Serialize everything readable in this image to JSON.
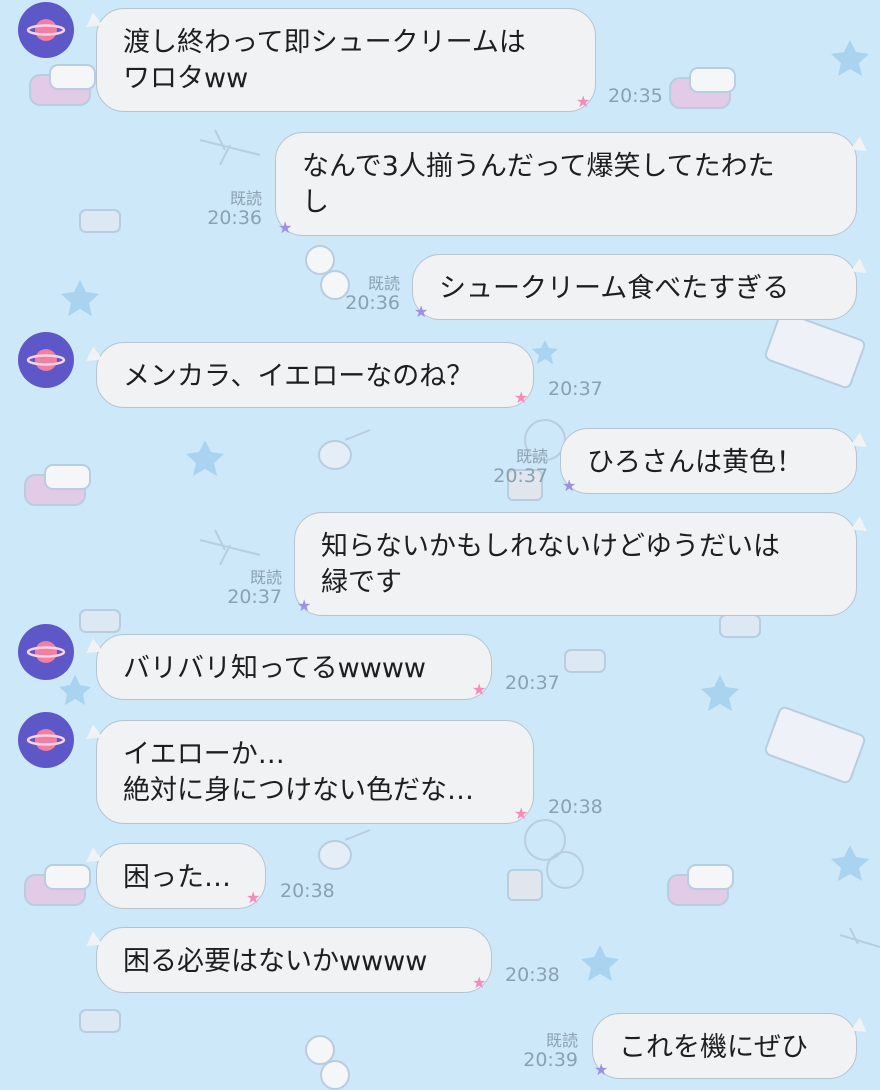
{
  "colors": {
    "background": "#cde8f8",
    "bubble": "#f1f2f4",
    "avatar": "#5d57c8",
    "star_pink": "#f58bb8",
    "star_purple": "#9b90e6"
  },
  "chat": {
    "read_label": "既読",
    "messages": [
      {
        "side": "left",
        "text": "渡し終わって即シュークリームは\nワロタww",
        "time": "20:35"
      },
      {
        "side": "right",
        "text": "なんで3人揃うんだって爆笑してたわた\nし",
        "time": "20:36"
      },
      {
        "side": "right",
        "text": "シュークリーム食べたすぎる",
        "time": "20:36"
      },
      {
        "side": "left",
        "text": "メンカラ、イエローなのね？",
        "time": "20:37"
      },
      {
        "side": "right",
        "text": "ひろさんは黄色！",
        "time": "20:37"
      },
      {
        "side": "right",
        "text": "知らないかもしれないけどゆうだいは\n緑です",
        "time": "20:37"
      },
      {
        "side": "left",
        "text": "バリバリ知ってるwwww",
        "time": "20:37"
      },
      {
        "side": "left",
        "text": "イエローか…\n絶対に身につけない色だな…",
        "time": "20:38"
      },
      {
        "side": "left",
        "text": "困った…",
        "time": "20:38"
      },
      {
        "side": "left",
        "text": "困る必要はないかwwww",
        "time": "20:38"
      },
      {
        "side": "right",
        "text": "これを機にぜひ",
        "time": "20:39"
      }
    ]
  }
}
